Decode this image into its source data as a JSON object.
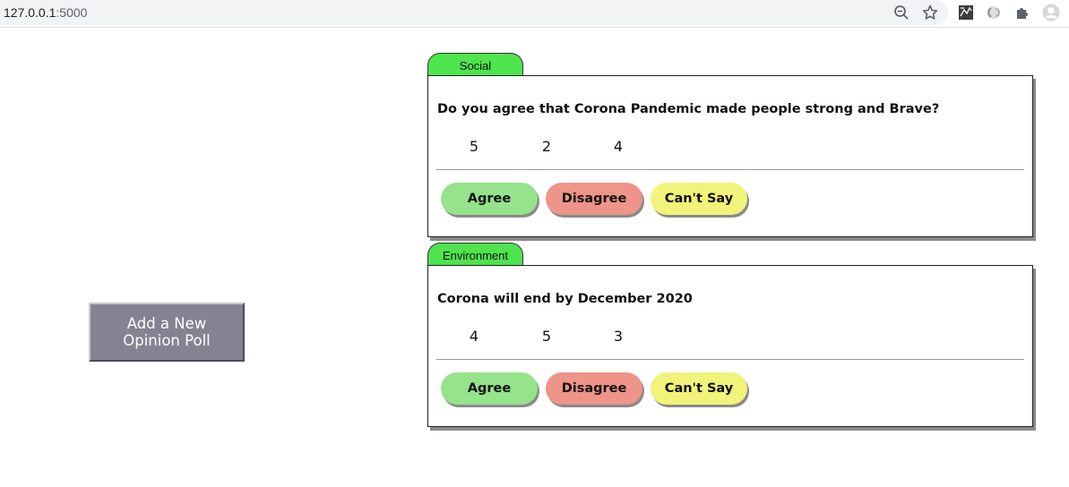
{
  "browser": {
    "url_host": "127.0.0.1",
    "url_port": ":5000",
    "icons": [
      "zoom-out-icon",
      "bookmark-star-icon",
      "extension-icon",
      "extension-icon-2",
      "extensions-puzzle-icon",
      "profile-avatar-icon"
    ]
  },
  "sidebar": {
    "add_poll_label": "Add a New Opinion Poll"
  },
  "polls": [
    {
      "category": "Social",
      "question": "Do you agree that Corona Pandemic made people strong and Brave?",
      "counts": [
        "5",
        "2",
        "4"
      ],
      "buttons": {
        "agree": "Agree",
        "disagree": "Disagree",
        "cant_say": "Can't Say"
      }
    },
    {
      "category": "Environment",
      "question": "Corona will end by December 2020",
      "counts": [
        "4",
        "5",
        "3"
      ],
      "buttons": {
        "agree": "Agree",
        "disagree": "Disagree",
        "cant_say": "Can't Say"
      }
    }
  ],
  "colors": {
    "tab": "#4ee44e",
    "agree": "#95e38a",
    "disagree": "#ee9488",
    "cant_say": "#f2f37a",
    "add_poll": "#858291"
  }
}
